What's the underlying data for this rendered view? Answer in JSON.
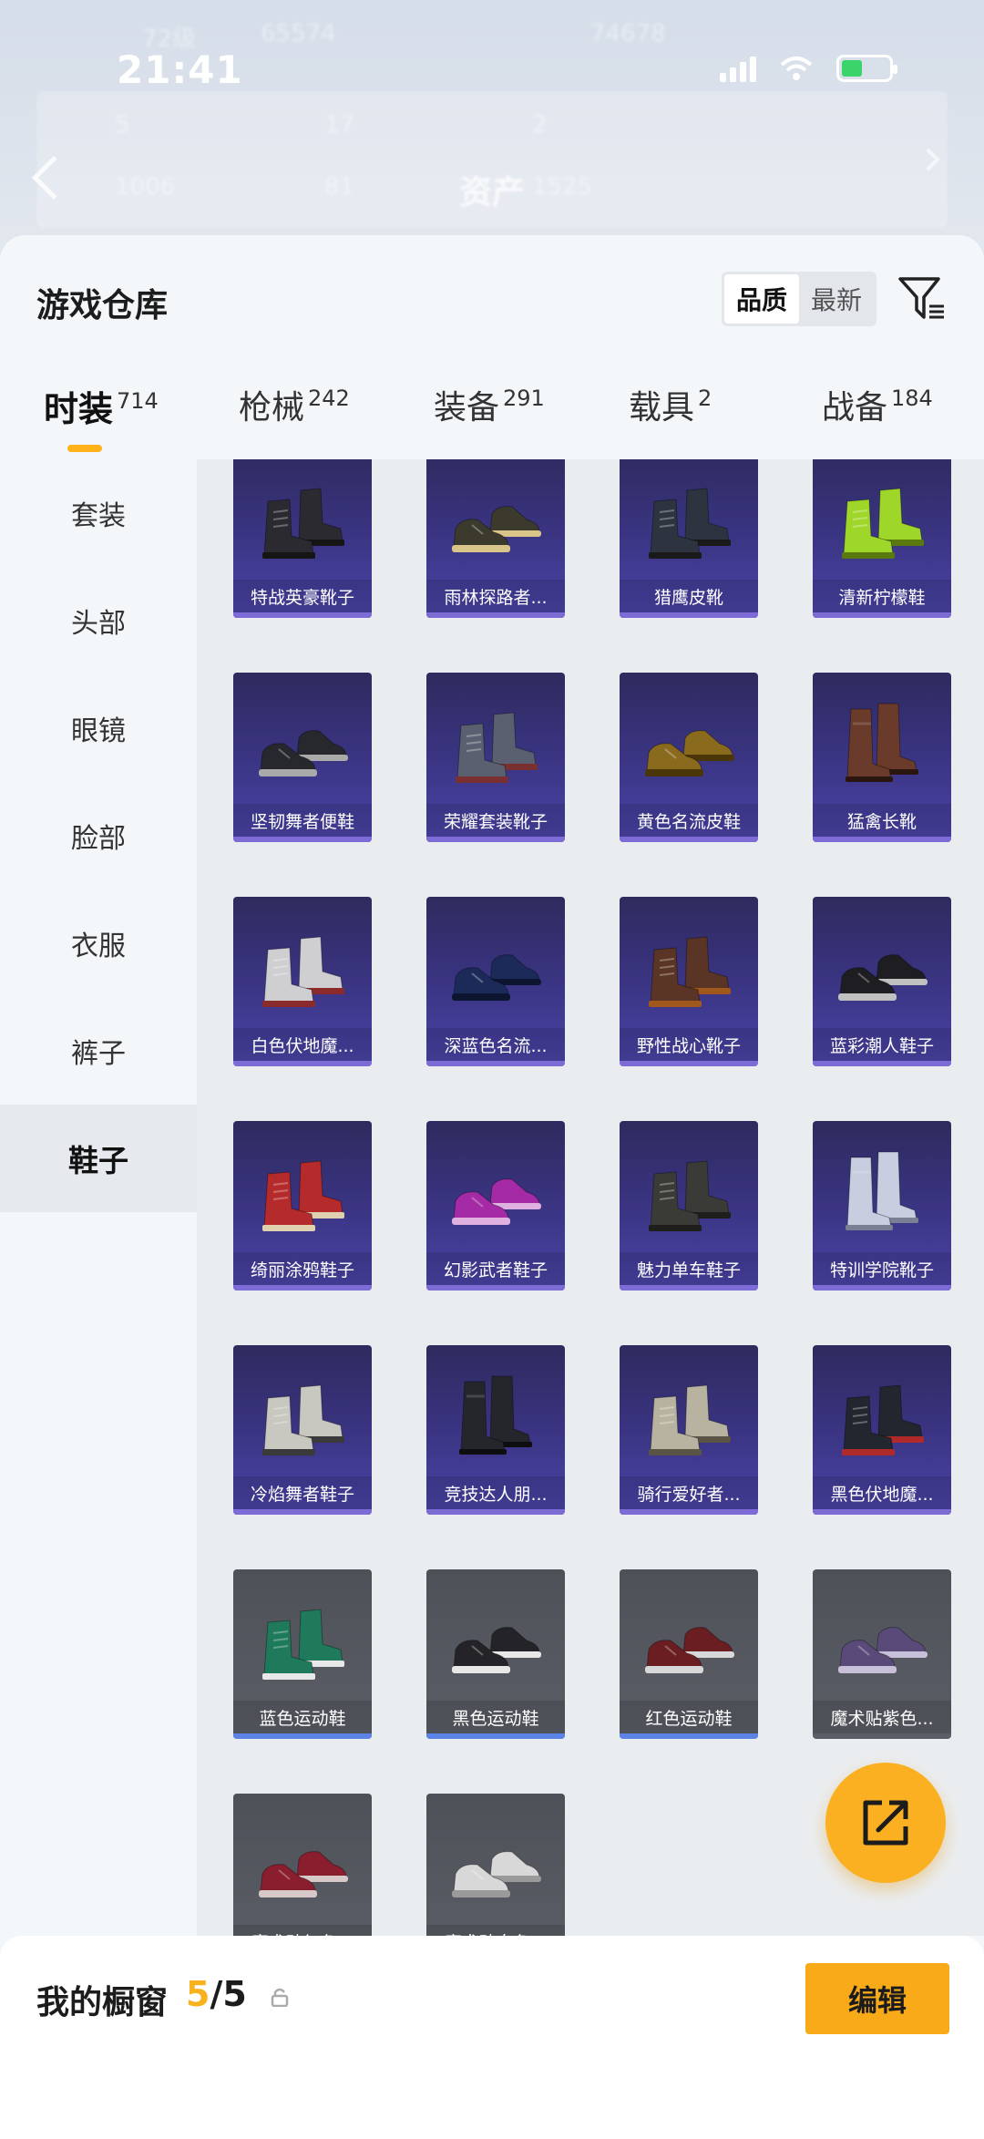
{
  "status_bar": {
    "time": "21:41"
  },
  "background_ghost": {
    "level": "72级",
    "coins": "65574",
    "coins2": "74678",
    "stats": [
      "5",
      "17",
      "2",
      "1006",
      "81",
      "1525"
    ],
    "assets_label": "资产"
  },
  "header": {
    "title": "游戏仓库",
    "sort_options": [
      "品质",
      "最新"
    ],
    "active_sort": "品质"
  },
  "tabs": [
    {
      "label": "时装",
      "count": "714"
    },
    {
      "label": "枪械",
      "count": "242"
    },
    {
      "label": "装备",
      "count": "291"
    },
    {
      "label": "载具",
      "count": "2"
    },
    {
      "label": "战备",
      "count": "184"
    }
  ],
  "active_tab": "时装",
  "sidebar": {
    "items": [
      "套装",
      "头部",
      "眼镜",
      "脸部",
      "衣服",
      "裤子",
      "鞋子"
    ],
    "active": "鞋子"
  },
  "items": [
    {
      "name": "特战英豪靴子",
      "rarity": "purple",
      "color": "#2a2a30",
      "sole": "#151515",
      "style": "boot"
    },
    {
      "name": "雨林探路者...",
      "rarity": "purple",
      "color": "#3b3a2c",
      "sole": "#d9c48a",
      "style": "sneaker"
    },
    {
      "name": "猎鹰皮靴",
      "rarity": "purple",
      "color": "#2e3340",
      "sole": "#1a1a1a",
      "style": "boot"
    },
    {
      "name": "清新柠檬鞋",
      "rarity": "purple",
      "color": "#9fd62a",
      "sole": "#5a7a10",
      "style": "hightop"
    },
    {
      "name": "坚韧舞者便鞋",
      "rarity": "purple",
      "color": "#26282e",
      "sole": "#aaaaaa",
      "style": "sneaker"
    },
    {
      "name": "荣耀套装靴子",
      "rarity": "purple",
      "color": "#5b6070",
      "sole": "#7a3030",
      "style": "hightop"
    },
    {
      "name": "黄色名流皮鞋",
      "rarity": "purple",
      "color": "#8a6a1c",
      "sole": "#4a3608",
      "style": "shoe"
    },
    {
      "name": "猛禽长靴",
      "rarity": "purple",
      "color": "#6a3a2a",
      "sole": "#2a1510",
      "style": "tallboot"
    },
    {
      "name": "白色伏地魔...",
      "rarity": "purple",
      "color": "#cfcfd2",
      "sole": "#8a2a2a",
      "style": "hightop"
    },
    {
      "name": "深蓝色名流...",
      "rarity": "purple",
      "color": "#1c2a5a",
      "sole": "#0e1530",
      "style": "shoe"
    },
    {
      "name": "野性战心靴子",
      "rarity": "purple",
      "color": "#5a3424",
      "sole": "#a0581c",
      "style": "boot"
    },
    {
      "name": "蓝彩潮人鞋子",
      "rarity": "purple",
      "color": "#1e1e22",
      "sole": "#c0c0c0",
      "style": "shoe"
    },
    {
      "name": "绮丽涂鸦鞋子",
      "rarity": "purple",
      "color": "#b52a2a",
      "sole": "#e0d0b0",
      "style": "hightop"
    },
    {
      "name": "幻影武者鞋子",
      "rarity": "purple",
      "color": "#a52aa5",
      "sole": "#e0b0e0",
      "style": "sneaker"
    },
    {
      "name": "魅力单车鞋子",
      "rarity": "purple",
      "color": "#3a3a36",
      "sole": "#1e1e1c",
      "style": "boot"
    },
    {
      "name": "特训学院靴子",
      "rarity": "purple",
      "color": "#c8cde0",
      "sole": "#7a7f94",
      "style": "tallboot"
    },
    {
      "name": "冷焰舞者鞋子",
      "rarity": "purple",
      "color": "#c8c8c0",
      "sole": "#3a3a3a",
      "style": "hightop"
    },
    {
      "name": "竞技达人朋...",
      "rarity": "purple",
      "color": "#24262c",
      "sole": "#0e0e10",
      "style": "tallboot"
    },
    {
      "name": "骑行爱好者...",
      "rarity": "purple",
      "color": "#b8b3a0",
      "sole": "#5a5444",
      "style": "boot"
    },
    {
      "name": "黑色伏地魔...",
      "rarity": "purple",
      "color": "#22262e",
      "sole": "#b02a2a",
      "style": "hightop"
    },
    {
      "name": "蓝色运动鞋",
      "rarity": "grey",
      "color": "#1e7a5a",
      "sole": "#e8e8e8",
      "style": "hightop"
    },
    {
      "name": "黑色运动鞋",
      "rarity": "grey",
      "color": "#242428",
      "sole": "#e8e8e8",
      "style": "sneaker"
    },
    {
      "name": "红色运动鞋",
      "rarity": "grey",
      "color": "#6a1e22",
      "sole": "#d8d8d8",
      "style": "sneaker"
    },
    {
      "name": "魔术贴紫色...",
      "rarity": "grey",
      "color": "#5a4a7a",
      "sole": "#c8c0d8",
      "style": "shoe"
    },
    {
      "name": "魔术贴红色...",
      "rarity": "grey",
      "color": "#8a1e2e",
      "sole": "#d8c8c8",
      "style": "shoe"
    },
    {
      "name": "魔术贴白色...",
      "rarity": "grey",
      "color": "#d8d8d8",
      "sole": "#9a9a9a",
      "style": "shoe"
    }
  ],
  "showcase": {
    "label": "我的橱窗",
    "current": "5",
    "separator": "/",
    "total": "5",
    "edit_label": "编辑"
  },
  "colors": {
    "accent": "#f9aa19",
    "purple_card": "#3a3482",
    "grey_card": "#55585f",
    "blue_rarity_line": "#5c84e6"
  }
}
